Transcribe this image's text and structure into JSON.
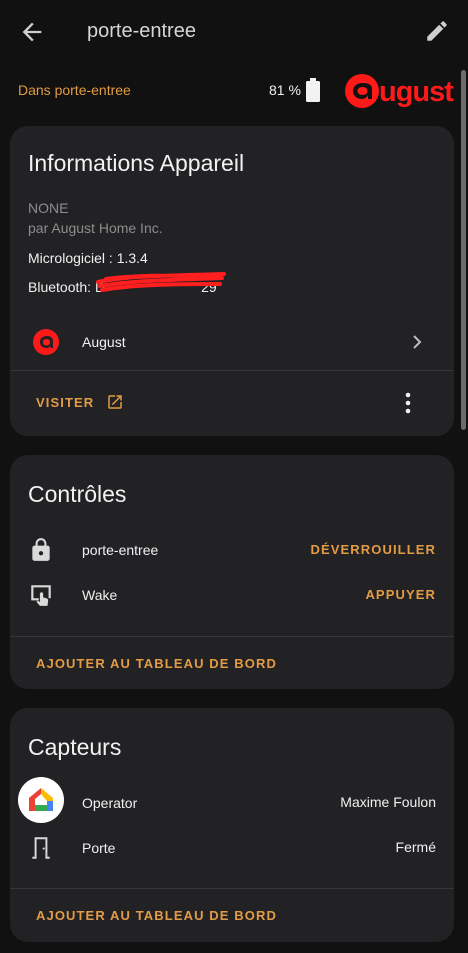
{
  "header": {
    "title": "porte-entree",
    "back_icon": "arrow-left-icon",
    "edit_icon": "pencil-icon"
  },
  "subheader": {
    "area": "Dans porte-entree",
    "battery": "81 %",
    "battery_icon": "battery-icon",
    "brand_logo": "august-logo"
  },
  "colors": {
    "accent": "#e39b45",
    "brand_red": "#ff1a1a",
    "card_bg": "#222225",
    "page_bg": "#111111"
  },
  "device_info": {
    "title": "Informations Appareil",
    "model": "NONE",
    "manufacturer": "par August Home Inc.",
    "firmware": "Micrologiciel : 1.3.4",
    "bluetooth_prefix": "Bluetooth: ",
    "bluetooth_visible": "D",
    "bluetooth_suffix": "29",
    "integration": "August",
    "visit_label": "VISITER"
  },
  "controls": {
    "title": "Contrôles",
    "items": [
      {
        "label": "porte-entree",
        "action": "DÉVERROUILLER",
        "icon": "lock-icon"
      },
      {
        "label": "Wake",
        "action": "APPUYER",
        "icon": "touch-screen-icon"
      }
    ],
    "add_to_dashboard": "AJOUTER AU TABLEAU DE BORD"
  },
  "sensors": {
    "title": "Capteurs",
    "items": [
      {
        "label": "Operator",
        "value": "Maxime Foulon",
        "icon": "google-home-icon"
      },
      {
        "label": "Porte",
        "value": "Fermé",
        "icon": "door-icon"
      }
    ],
    "add_to_dashboard": "AJOUTER AU TABLEAU DE BORD"
  }
}
